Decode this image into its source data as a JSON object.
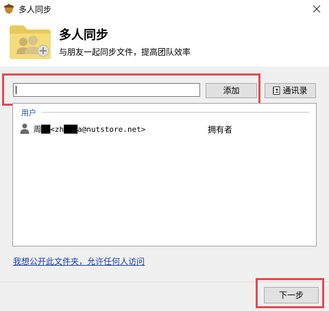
{
  "window": {
    "title": "多人同步",
    "icon": "acorn-icon",
    "close_icon": "close-icon"
  },
  "header": {
    "title": "多人同步",
    "subtitle": "与朋友一起同步文件，提高团队效率",
    "icon": "shared-folder-icon"
  },
  "invite": {
    "input_value": "",
    "add_label": "添加",
    "contacts_label": "通讯录",
    "contacts_icon": "address-book-icon"
  },
  "users": {
    "group_label": "用户",
    "rows": [
      {
        "icon": "user-icon",
        "name": "周██<zh███a@nutstore.net>",
        "role": "拥有者"
      }
    ]
  },
  "public_link": "我想公开此文件夹，允许任何人访问",
  "footer": {
    "next_label": "下一步"
  },
  "colors": {
    "highlight": "#e34a52",
    "link": "#1a3fb0",
    "group_label": "#1a4ea0"
  }
}
